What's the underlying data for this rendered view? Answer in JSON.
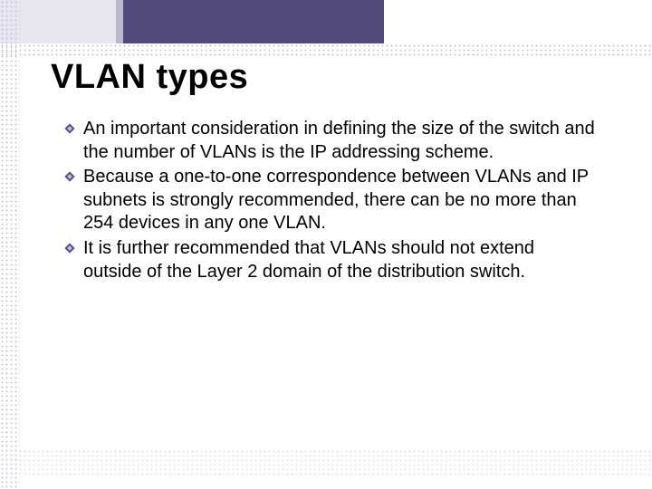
{
  "title": "VLAN types",
  "bullets": [
    "An important consideration in defining the size of the switch and the number of VLANs is the IP addressing scheme.",
    "Because a one-to-one correspondence between VLANs and IP subnets is strongly recommended, there can be no more than 254 devices in any one VLAN.",
    "It is further recommended that VLANs should not extend outside of the Layer 2 domain of the distribution switch."
  ]
}
